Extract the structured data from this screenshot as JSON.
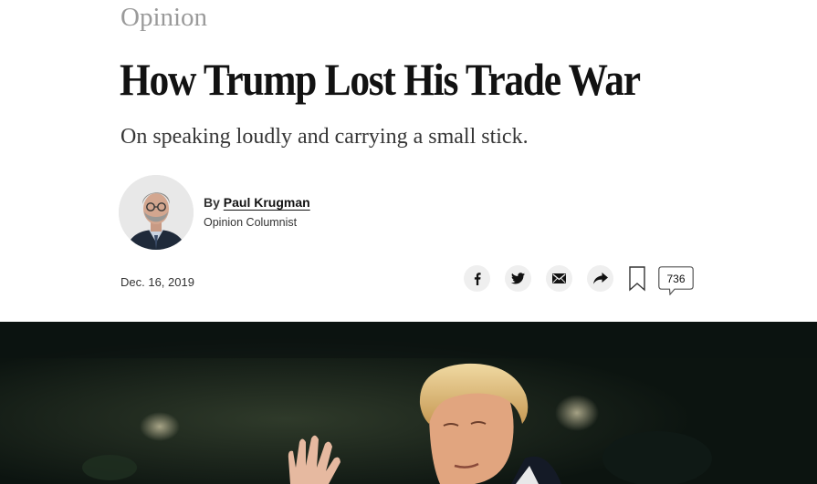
{
  "article": {
    "section": "Opinion",
    "headline": "How Trump Lost His Trade War",
    "summary": "On speaking loudly and carrying a small stick.",
    "byline": {
      "prefix": "By",
      "author": "Paul Krugman",
      "role": "Opinion Columnist"
    },
    "date": "Dec. 16, 2019"
  },
  "share": {
    "items": [
      {
        "icon": "facebook-icon"
      },
      {
        "icon": "twitter-icon"
      },
      {
        "icon": "email-icon"
      },
      {
        "icon": "share-arrow-icon"
      }
    ],
    "bookmark_icon": "bookmark-icon",
    "comment_count": "736"
  },
  "colors": {
    "section_label": "#9a9a9a",
    "text": "#121212",
    "share_button_bg": "#efefef",
    "hero_background": "#0d1512"
  }
}
